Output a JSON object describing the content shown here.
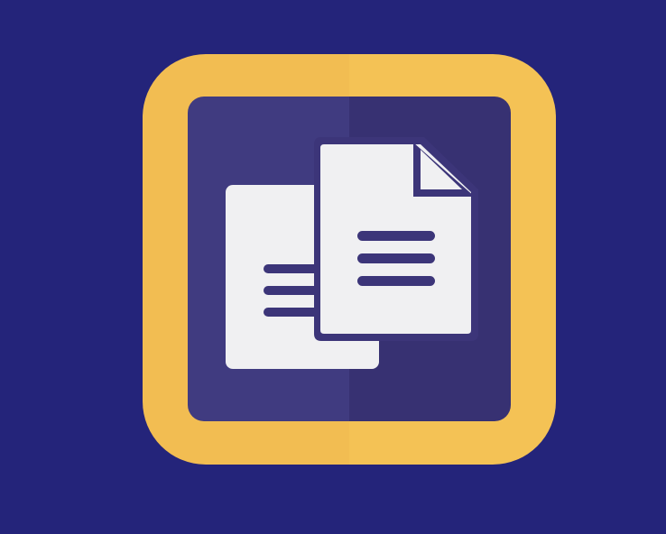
{
  "icon": {
    "name": "documents-copy-icon",
    "colors": {
      "background": "#24247a",
      "frame": "#f2bd52",
      "frame_shade": "#f4c255",
      "panel_left": "#403b80",
      "panel_right": "#373172",
      "paper": "#f0f0f2",
      "lines": "#3c3579"
    }
  }
}
